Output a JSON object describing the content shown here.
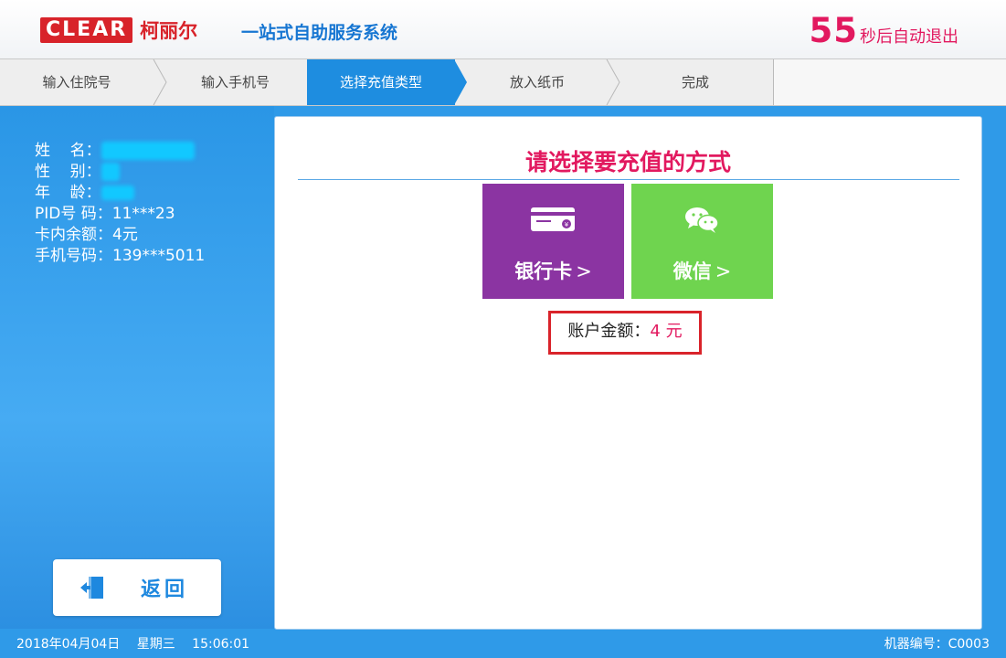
{
  "header": {
    "logo_mark": "CLEAR",
    "logo_cn": "柯丽尔",
    "system_title": "一站式自助服务系统",
    "countdown_seconds": "55",
    "countdown_text": "秒后自动退出"
  },
  "steps": [
    {
      "label": "输入住院号",
      "active": false
    },
    {
      "label": "输入手机号",
      "active": false
    },
    {
      "label": "选择充值类型",
      "active": true
    },
    {
      "label": "放入纸币",
      "active": false
    },
    {
      "label": "完成",
      "active": false
    }
  ],
  "patient": {
    "name_label": "姓    名：",
    "gender_label": "性    别：",
    "age_label": "年    龄：",
    "pid_label": "PID号 码：",
    "pid_value": "11***23",
    "balance_label": "卡内余额：",
    "balance_value": "4元",
    "phone_label": "手机号码：",
    "phone_value": "139***5011"
  },
  "back_button": {
    "label": "返回"
  },
  "main": {
    "title": "请选择要充值的方式",
    "methods": [
      {
        "label": "银行卡",
        "arrow": ">",
        "icon": "bank-card-icon",
        "color": "#8b34a2"
      },
      {
        "label": "微信",
        "arrow": ">",
        "icon": "wechat-icon",
        "color": "#6fd44f"
      }
    ],
    "account_label": "账户金额：",
    "account_value": "4 元"
  },
  "footer": {
    "date": "2018年04月04日",
    "weekday": "星期三",
    "time": "15:06:01",
    "machine_id": "机器编号：C0003"
  },
  "colors": {
    "accent_blue": "#1e8de0",
    "highlight_pink": "#e2195f",
    "brand_red": "#d8232a"
  }
}
